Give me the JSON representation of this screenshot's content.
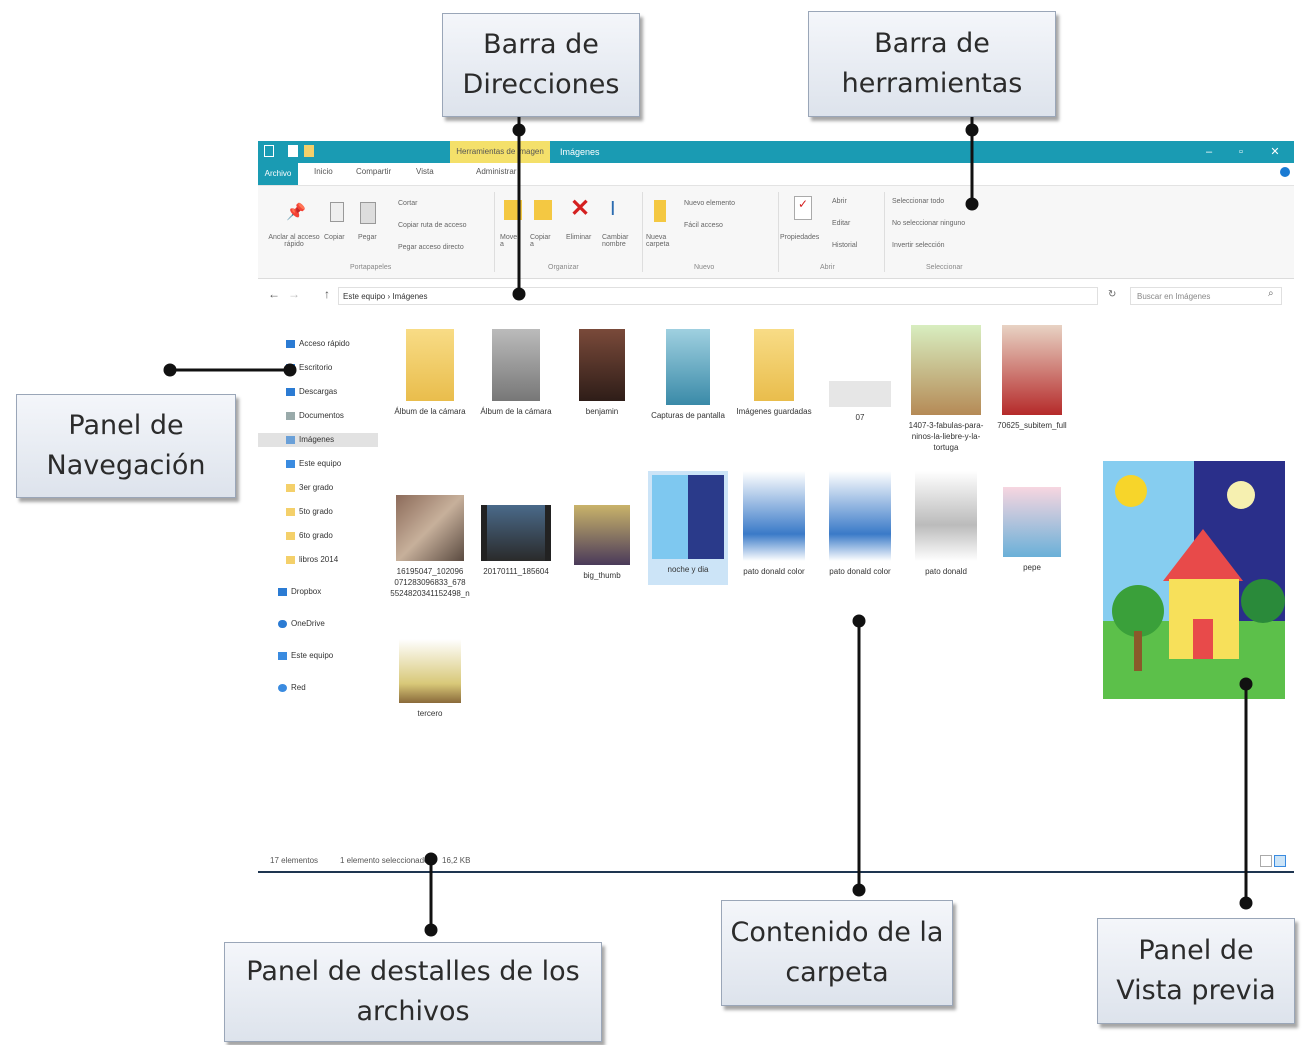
{
  "callouts": {
    "barra_direcciones": "Barra de Direcciones",
    "barra_herramientas": "Barra de herramientas",
    "panel_navegacion": "Panel de Navegación",
    "panel_detalles": "Panel de destalles de los archivos",
    "contenido_carpeta": "Contenido de la carpeta",
    "panel_vista_previa": "Panel de Vista previa"
  },
  "window": {
    "contextual_tab": "Herramientas de imagen",
    "title": "Imágenes",
    "controls": {
      "minimize": "–",
      "maximize": "▫",
      "close": "✕"
    },
    "tabs": [
      "Archivo",
      "Inicio",
      "Compartir",
      "Vista",
      "Administrar"
    ]
  },
  "ribbon": {
    "pin": "Anclar al acceso rápido",
    "copy": "Copiar",
    "paste": "Pegar",
    "cut": "Cortar",
    "copy_path": "Copiar ruta de acceso",
    "paste_shortcut": "Pegar acceso directo",
    "move_to": "Mover a",
    "copy_to": "Copiar a",
    "delete": "Eliminar",
    "rename": "Cambiar nombre",
    "new_folder": "Nueva carpeta",
    "new_item": "Nuevo elemento",
    "easy_access": "Fácil acceso",
    "properties": "Propiedades",
    "open": "Abrir",
    "edit": "Editar",
    "history": "Historial",
    "select_all": "Seleccionar todo",
    "select_none": "No seleccionar ninguno",
    "invert_selection": "Invertir selección",
    "groups": [
      "Portapapeles",
      "Organizar",
      "Nuevo",
      "Abrir",
      "Seleccionar"
    ]
  },
  "address": {
    "path": "Este equipo › Imágenes",
    "search_placeholder": "Buscar en Imágenes"
  },
  "navigation": [
    "Acceso rápido",
    "Escritorio",
    "Descargas",
    "Documentos",
    "Imágenes",
    "Este equipo",
    "3er grado",
    "5to grado",
    "6to grado",
    "libros 2014",
    "Dropbox",
    "OneDrive",
    "Este equipo",
    "Red"
  ],
  "files": [
    "Álbum de la cámara",
    "Álbum de la cámara",
    "benjamin",
    "Capturas de pantalla",
    "Imágenes guardadas",
    "07",
    "1407-3-fabulas-para-ninos-la-liebre-y-la-tortuga",
    "70625_subitem_full",
    "16195047_102096 071283096833_678 5524820341152498_n",
    "20170111_185604",
    "big_thumb",
    "noche y dia",
    "pato donald color",
    "pato donald color",
    "pato donald",
    "pepe",
    "tercero"
  ],
  "status": {
    "items": "17 elementos",
    "selected": "1 elemento seleccionado",
    "size": "16,2 KB"
  }
}
